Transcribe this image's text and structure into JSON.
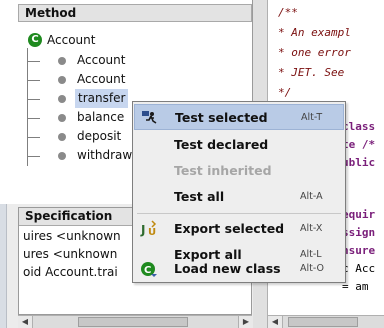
{
  "method_panel": {
    "header": "Method",
    "class_item": "Account",
    "members": [
      "Account",
      "Account",
      "transfer",
      "balance",
      "deposit",
      "withdraw"
    ]
  },
  "spec_panel": {
    "header": "Specification",
    "lines": [
      "uires <unknown",
      "ures <unknown",
      "oid Account.trai"
    ]
  },
  "editor": {
    "lines": [
      "/**",
      " * An exampl",
      " * one error",
      " * JET. See",
      " */",
      "class",
      "te /*",
      "ublic",
      "",
      "equir",
      "ssign",
      "nsure",
      "c Acc",
      "= am"
    ]
  },
  "context_menu": {
    "items": [
      {
        "label": "Test selected",
        "accel": "Alt-T",
        "icon": "run-test-icon",
        "state": "active"
      },
      {
        "label": "Test declared",
        "accel": "",
        "icon": "",
        "state": "enabled"
      },
      {
        "label": "Test inherited",
        "accel": "",
        "icon": "",
        "state": "disabled"
      },
      {
        "label": "Test all",
        "accel": "Alt-A",
        "icon": "",
        "state": "enabled"
      },
      {
        "label": "Export selected",
        "accel": "Alt-X",
        "icon": "export-junit-icon",
        "state": "enabled"
      },
      {
        "label": "Export all",
        "accel": "Alt-L",
        "icon": "",
        "state": "enabled"
      },
      {
        "label": "Load new class",
        "accel": "Alt-O",
        "icon": "load-class-icon",
        "state": "enabled"
      }
    ]
  },
  "colors": {
    "class_icon": "#1f8a1f",
    "menu_highlight": "#b9cbe6",
    "comment": "#7a0e0e",
    "keyword": "#7a1f7a"
  }
}
